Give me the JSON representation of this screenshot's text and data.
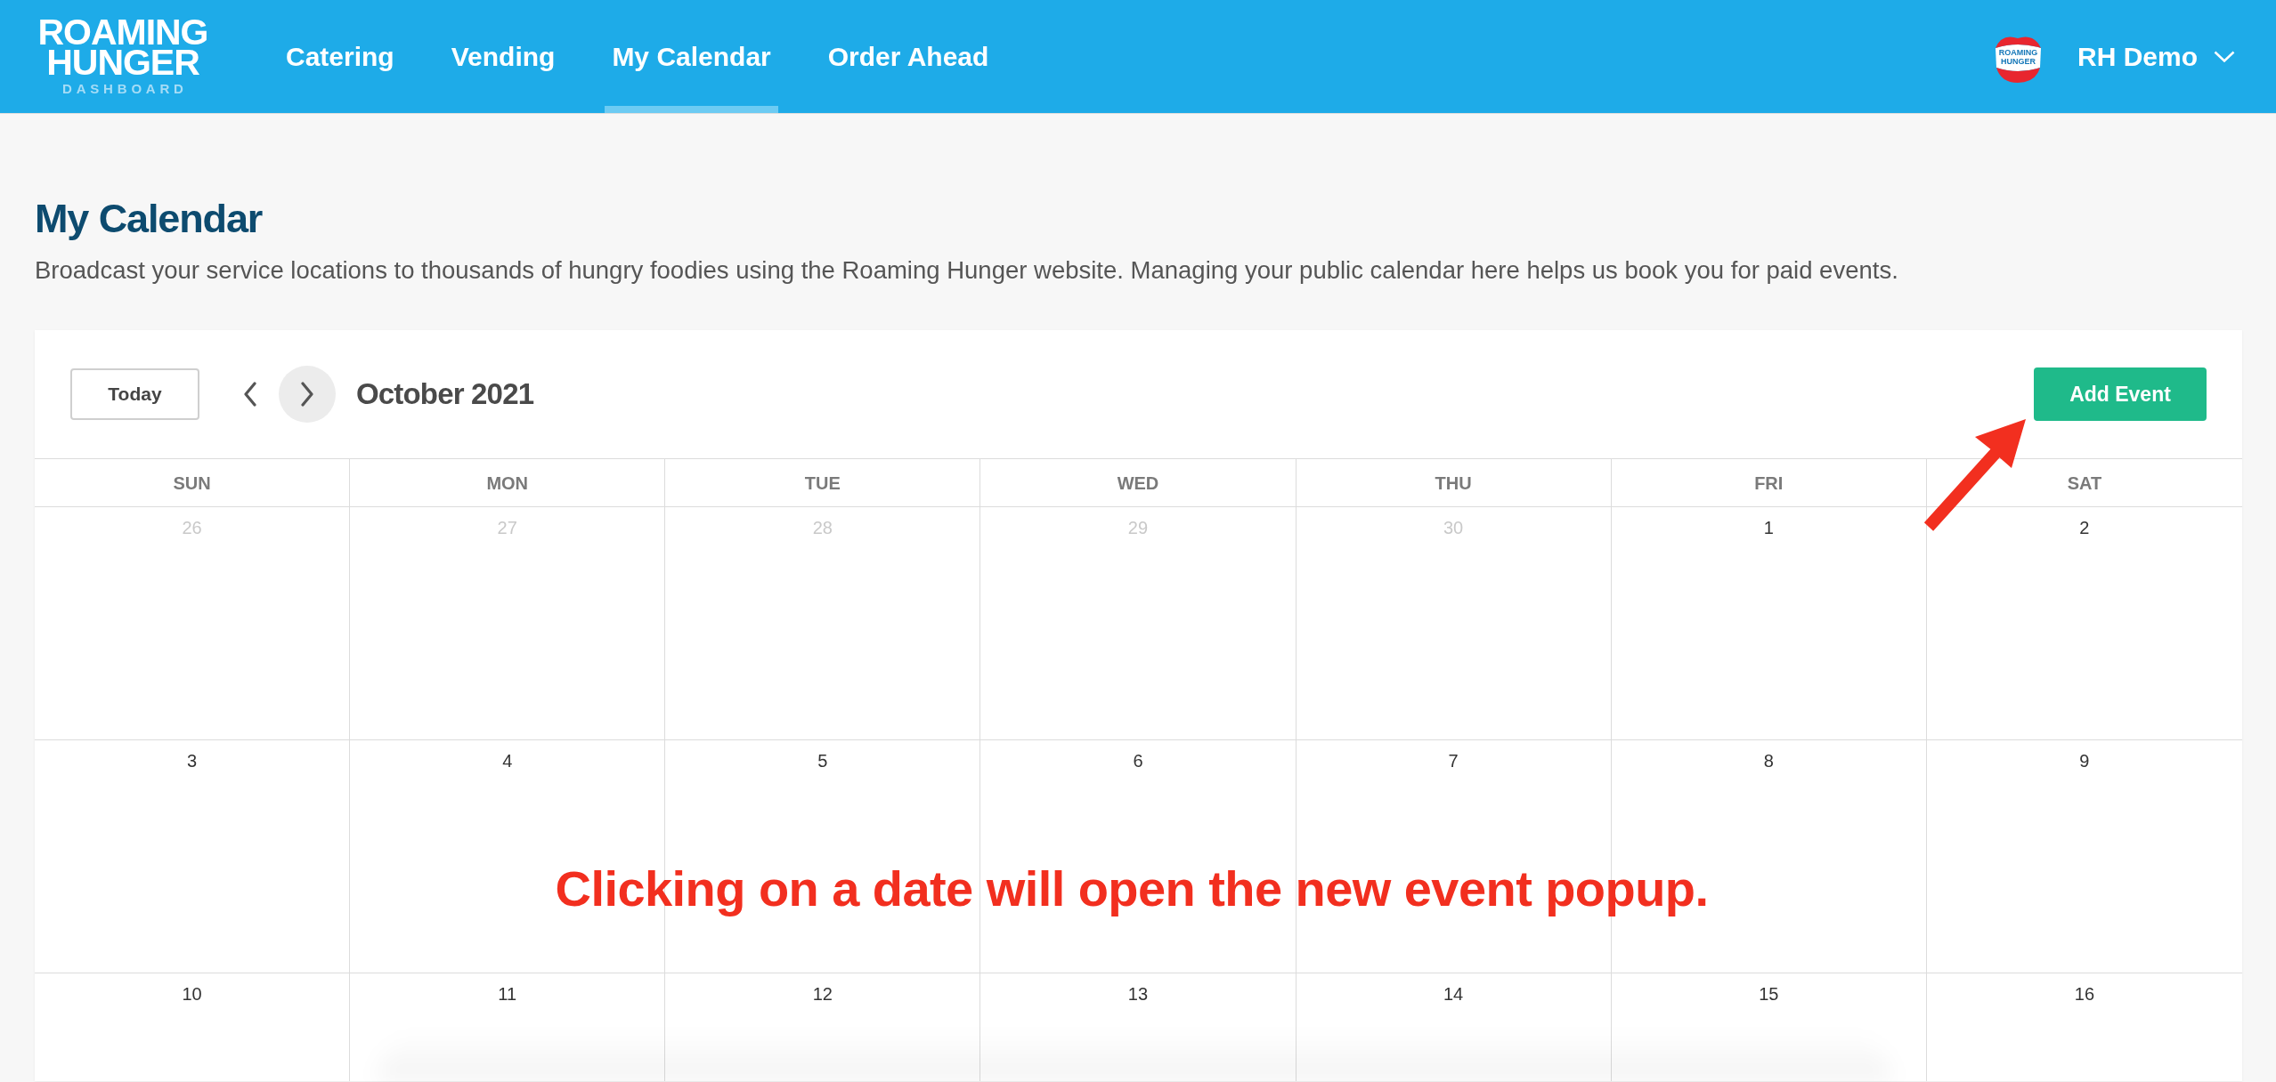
{
  "header": {
    "logo": {
      "wordmark": "ROAMING HUNGER",
      "subtitle": "DASHBOARD"
    },
    "tabs": [
      {
        "label": "Catering",
        "selected": false
      },
      {
        "label": "Vending",
        "selected": false
      },
      {
        "label": "My Calendar",
        "selected": true
      },
      {
        "label": "Order Ahead",
        "selected": false
      }
    ],
    "account": {
      "avatar_text": "ROAMING HUNGER",
      "name": "RH Demo"
    }
  },
  "page": {
    "title": "My Calendar",
    "description": "Broadcast your service locations to thousands of hungry foodies using the Roaming Hunger website. Managing your public calendar here helps us book you for paid events."
  },
  "calendar": {
    "today_button": "Today",
    "month_nav": [
      {
        "kind": "previous",
        "highlighted": false
      },
      {
        "kind": "next",
        "highlighted": true
      }
    ],
    "month": "October 2021",
    "add_button": "Add Event",
    "weekdays": [
      "SUN",
      "MON",
      "TUE",
      "WED",
      "THU",
      "FRI",
      "SAT"
    ],
    "weeks": [
      [
        {
          "date": "26",
          "in_month": false
        },
        {
          "date": "27",
          "in_month": false
        },
        {
          "date": "28",
          "in_month": false
        },
        {
          "date": "29",
          "in_month": false
        },
        {
          "date": "30",
          "in_month": false
        },
        {
          "date": "1",
          "in_month": true
        },
        {
          "date": "2",
          "in_month": true
        }
      ],
      [
        {
          "date": "3",
          "in_month": true
        },
        {
          "date": "4",
          "in_month": true
        },
        {
          "date": "5",
          "in_month": true
        },
        {
          "date": "6",
          "in_month": true
        },
        {
          "date": "7",
          "in_month": true
        },
        {
          "date": "8",
          "in_month": true
        },
        {
          "date": "9",
          "in_month": true
        }
      ],
      [
        {
          "date": "10",
          "in_month": true
        },
        {
          "date": "11",
          "in_month": true
        },
        {
          "date": "12",
          "in_month": true
        },
        {
          "date": "13",
          "in_month": true
        },
        {
          "date": "14",
          "in_month": true
        },
        {
          "date": "15",
          "in_month": true
        },
        {
          "date": "16",
          "in_month": true
        }
      ]
    ]
  },
  "annotation": {
    "text": "Clicking on a date will open the new event popup."
  }
}
